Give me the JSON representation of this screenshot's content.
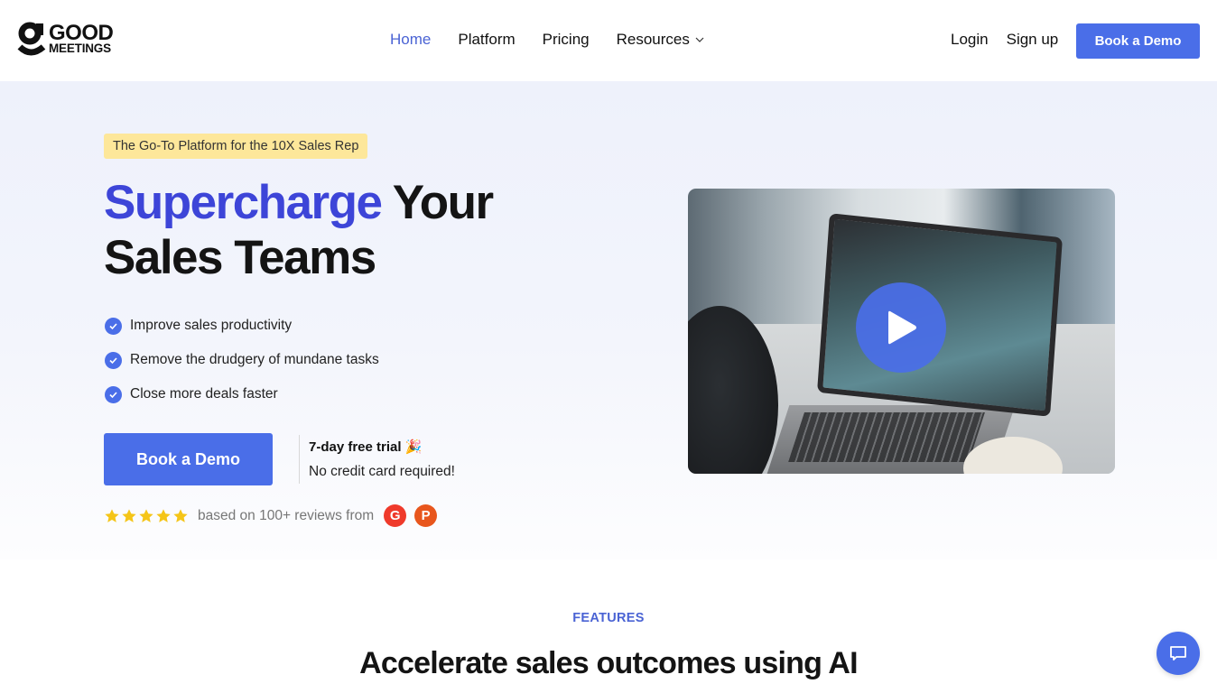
{
  "header": {
    "logo": {
      "line1": "GOOD",
      "line2": "MEETINGS"
    },
    "nav": [
      {
        "label": "Home",
        "active": true
      },
      {
        "label": "Platform"
      },
      {
        "label": "Pricing"
      },
      {
        "label": "Resources",
        "has_dropdown": true
      }
    ],
    "login_label": "Login",
    "signup_label": "Sign up",
    "book_demo_label": "Book a Demo"
  },
  "hero": {
    "tag": "The Go-To Platform for the 10X Sales Rep",
    "title_accent": "Supercharge",
    "title_rest_line1": " Your",
    "title_line2": "Sales Teams",
    "benefits": [
      "Improve sales productivity",
      "Remove the drudgery of mundane tasks",
      "Close more deals faster"
    ],
    "cta_label": "Book a Demo",
    "trial_label": "7-day free trial 🎉",
    "no_card_label": "No credit card required!",
    "rating_stars": 5,
    "reviews_text": "based on 100+ reviews from",
    "review_sources": [
      {
        "name": "G2",
        "glyph": "G"
      },
      {
        "name": "Product Hunt",
        "glyph": "P"
      }
    ],
    "video": {
      "icon": "play-icon"
    }
  },
  "features": {
    "label": "FEATURES",
    "title": "Accelerate sales outcomes using AI"
  },
  "chat": {
    "icon": "chat-bubble-icon"
  },
  "colors": {
    "primary": "#4a6ee8",
    "accent_text": "#3d45d8",
    "tag_bg": "#fde79a",
    "star": "#f5c518"
  }
}
